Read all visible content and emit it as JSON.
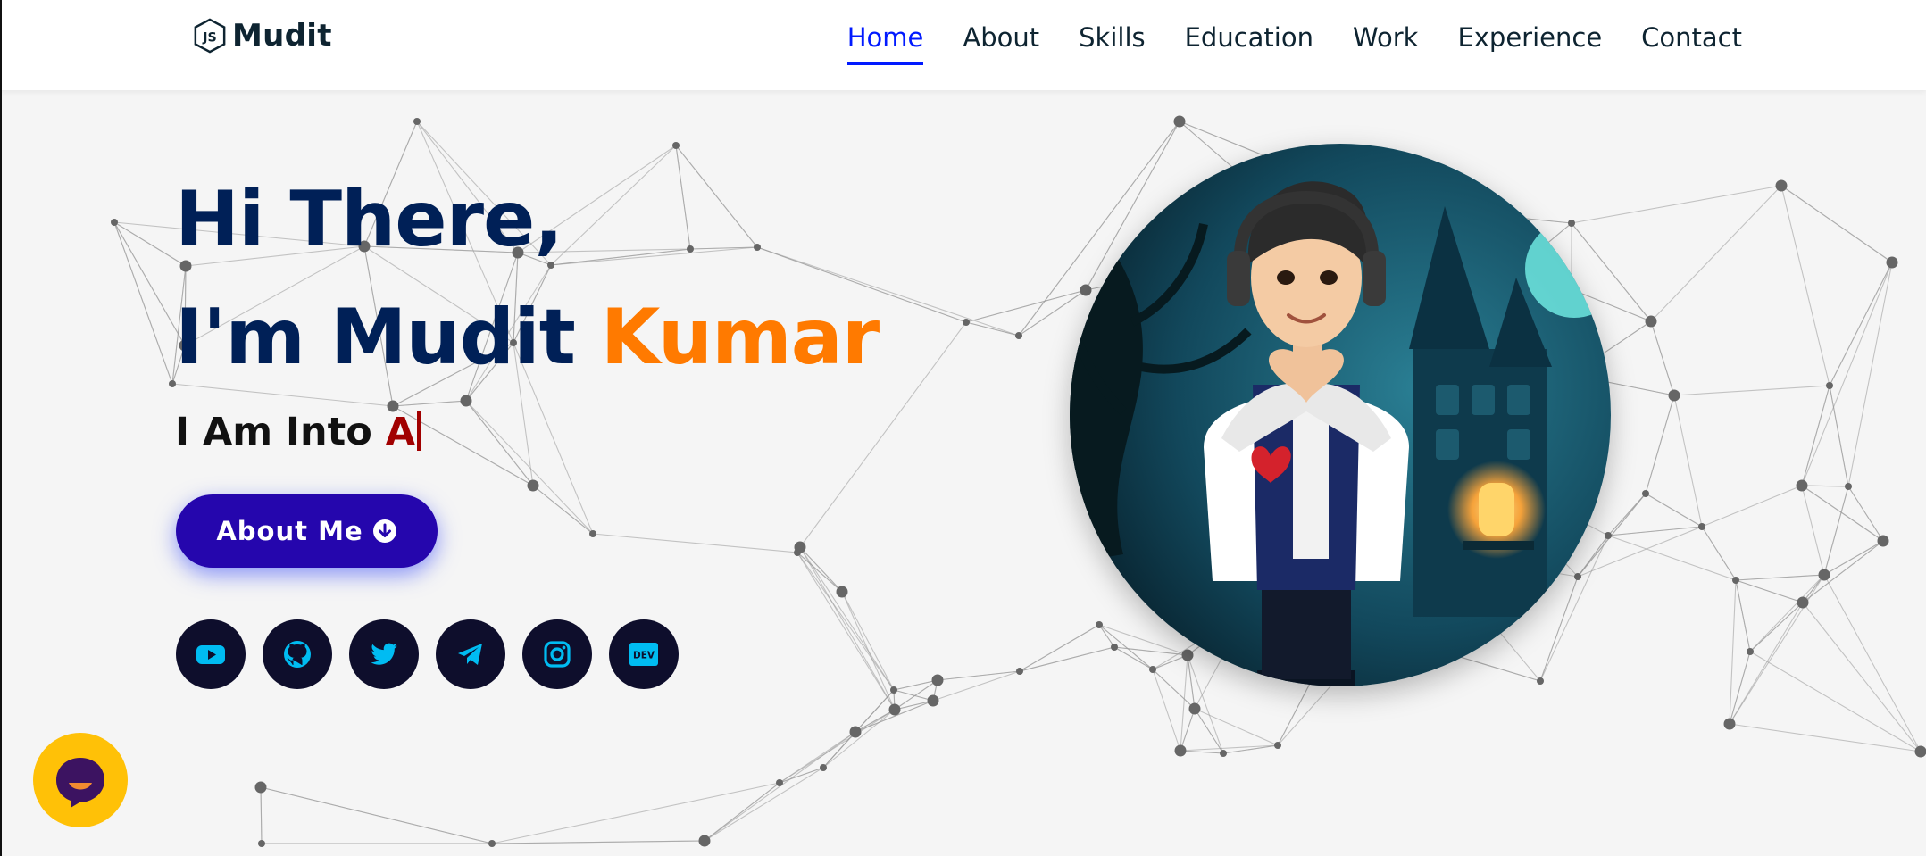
{
  "brand": {
    "name": "Mudit",
    "icon": "nodejs-hex-icon"
  },
  "nav": {
    "items": [
      {
        "label": "Home",
        "active": true
      },
      {
        "label": "About",
        "active": false
      },
      {
        "label": "Skills",
        "active": false
      },
      {
        "label": "Education",
        "active": false
      },
      {
        "label": "Work",
        "active": false
      },
      {
        "label": "Experience",
        "active": false
      },
      {
        "label": "Contact",
        "active": false
      }
    ]
  },
  "hero": {
    "greeting": "Hi There,",
    "intro_prefix": "I'm Mudit ",
    "intro_accent": "Kumar",
    "typing_prefix": "I Am Into ",
    "typing_text": "A",
    "about_button": "About Me"
  },
  "socials": [
    {
      "name": "youtube",
      "icon": "youtube-icon"
    },
    {
      "name": "github",
      "icon": "github-icon"
    },
    {
      "name": "twitter",
      "icon": "twitter-icon"
    },
    {
      "name": "telegram",
      "icon": "telegram-icon"
    },
    {
      "name": "instagram",
      "icon": "instagram-icon"
    },
    {
      "name": "dev",
      "icon": "dev-icon",
      "label": "DEV"
    }
  ],
  "colors": {
    "navy": "#002057",
    "accent_orange": "#ff7a00",
    "active_link": "#011aff",
    "button": "#2506ad",
    "social_bg": "#0e0e2c",
    "social_icon": "#00bcf2",
    "chat_bg": "#ffc107",
    "typed_text": "#a10000"
  }
}
